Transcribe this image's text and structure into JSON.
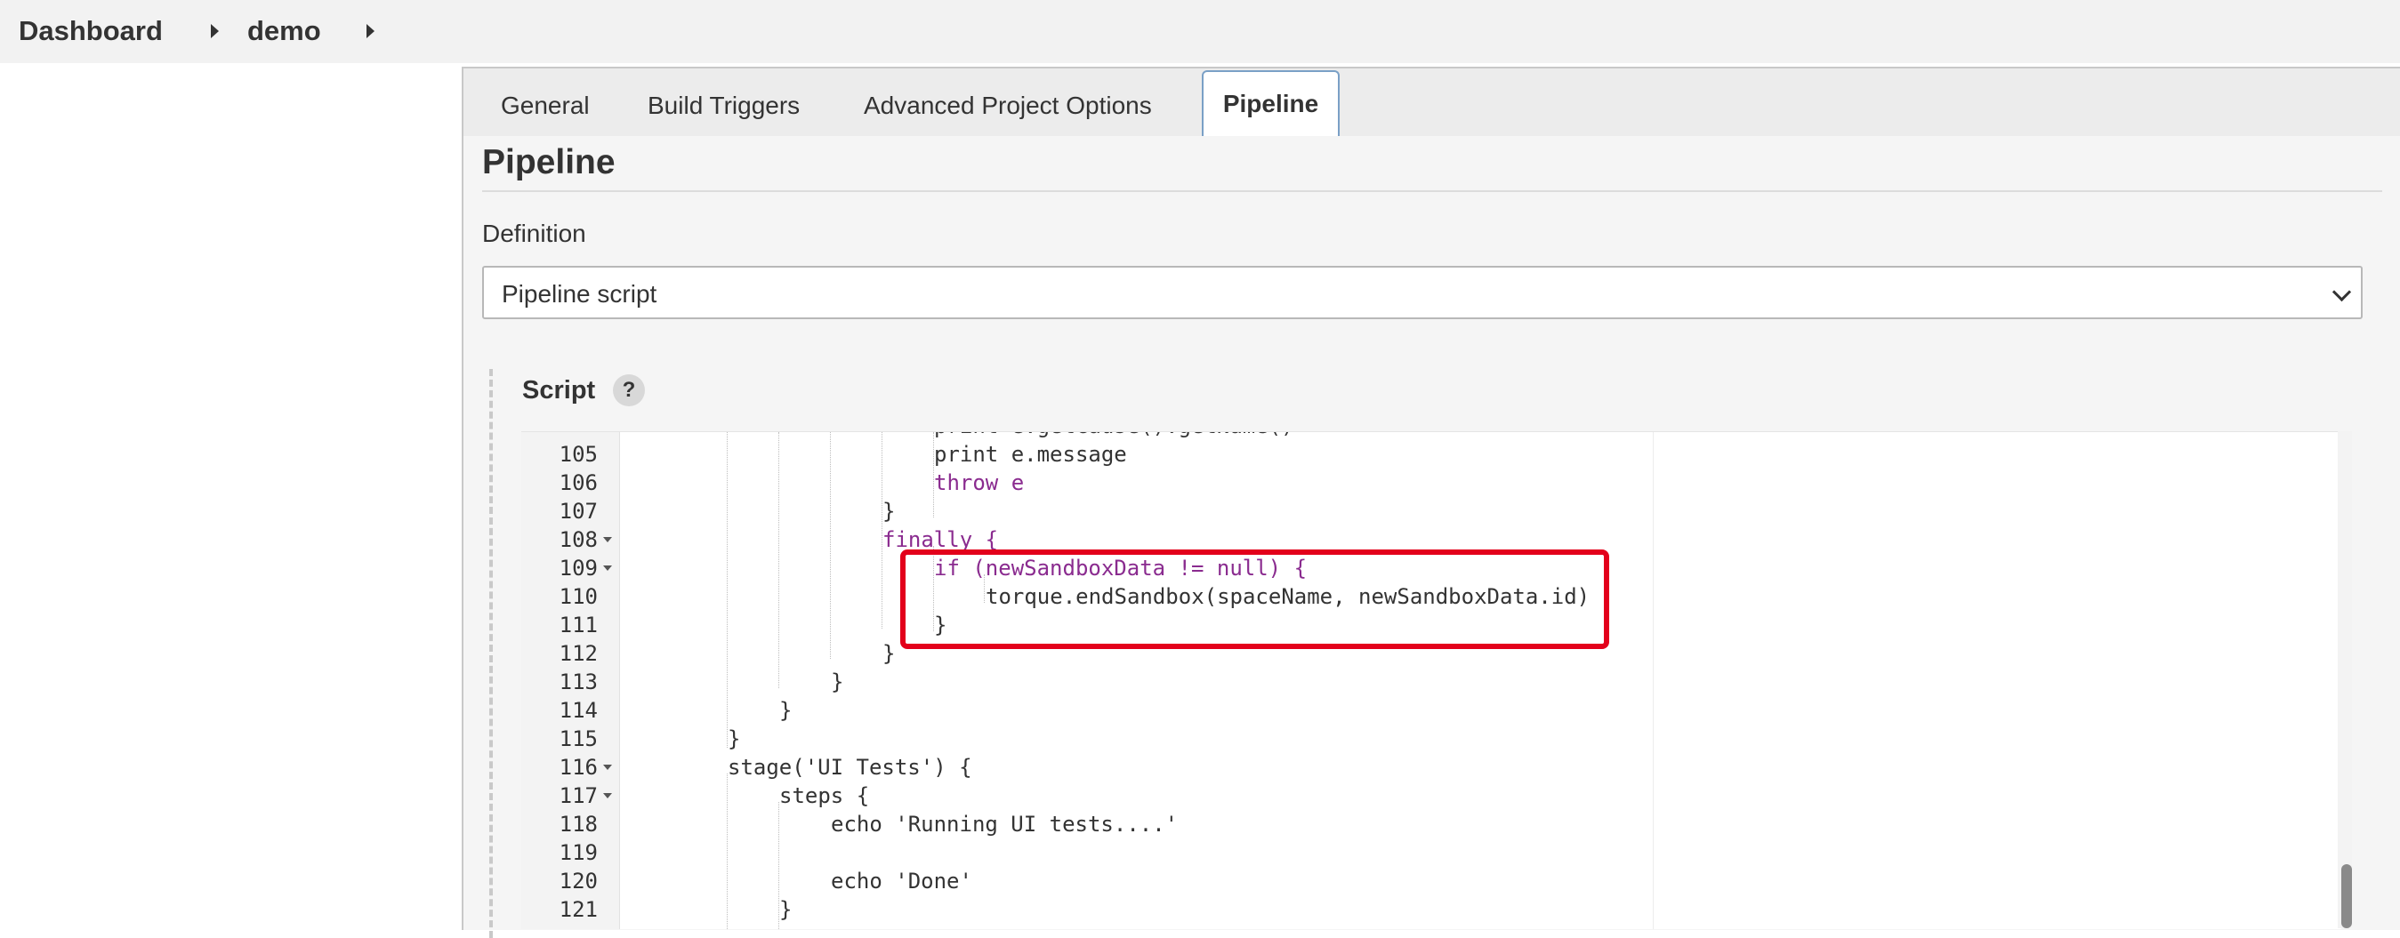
{
  "breadcrumb": {
    "items": [
      "Dashboard",
      "demo"
    ]
  },
  "tabs": [
    "General",
    "Build Triggers",
    "Advanced Project Options",
    "Pipeline"
  ],
  "active_tab": "Pipeline",
  "section": {
    "title": "Pipeline"
  },
  "definition": {
    "label": "Definition",
    "value": "Pipeline script"
  },
  "script": {
    "label": "Script",
    "help_icon": "?",
    "top_partial_line": "print e.getCause().getName()",
    "lines": [
      {
        "n": "105",
        "text": "print e.message"
      },
      {
        "n": "106",
        "text": "throw e"
      },
      {
        "n": "107",
        "text": "}"
      },
      {
        "n": "108",
        "text": "finally {"
      },
      {
        "n": "109",
        "text": "if (newSandboxData != null) {"
      },
      {
        "n": "110",
        "text": "torque.endSandbox(spaceName, newSandboxData.id)"
      },
      {
        "n": "111",
        "text": "}"
      },
      {
        "n": "112",
        "text": "}"
      },
      {
        "n": "113",
        "text": "}"
      },
      {
        "n": "114",
        "text": "}"
      },
      {
        "n": "115",
        "text": "}"
      },
      {
        "n": "116",
        "text": "stage('UI Tests') {"
      },
      {
        "n": "117",
        "text": "steps {"
      },
      {
        "n": "118",
        "text": "echo 'Running UI tests....'"
      },
      {
        "n": "119",
        "text": ""
      },
      {
        "n": "120",
        "text": "echo 'Done'"
      },
      {
        "n": "121",
        "text": "}"
      }
    ]
  },
  "colors": {
    "highlight_box": "#e3001b",
    "keyword": "#8a2b8f",
    "string": "#5a7a00",
    "null": "#cc7000",
    "tab_active_border": "#7aa0c6"
  }
}
